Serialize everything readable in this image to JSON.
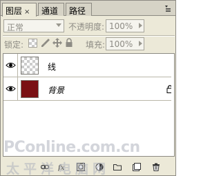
{
  "tabs": [
    {
      "label": "图层",
      "close": "×",
      "active": true
    },
    {
      "label": "通道",
      "active": false
    },
    {
      "label": "路径",
      "active": false
    }
  ],
  "panel_menu_icon": "panel-menu-icon",
  "blend_mode": {
    "value": "正常"
  },
  "opacity": {
    "label": "不透明度:",
    "value": "100%"
  },
  "lock": {
    "label": "锁定:",
    "icons": [
      "lock-transparent-icon",
      "lock-paint-icon",
      "lock-move-icon",
      "lock-all-icon"
    ]
  },
  "fill": {
    "label": "填充:",
    "value": "100%"
  },
  "layers": [
    {
      "name": "线",
      "visible": true,
      "thumbnail": "transparent",
      "locked": false,
      "italic": false
    },
    {
      "name": "背景",
      "visible": true,
      "thumbnail": "#7a1114",
      "locked": true,
      "italic": true
    }
  ],
  "bottom_toolbar": [
    "link-layers-icon",
    "layer-style-icon",
    "layer-mask-icon",
    "adjustment-layer-icon",
    "new-group-icon",
    "new-layer-icon",
    "delete-layer-icon"
  ],
  "watermark": {
    "main": "PConline.com.cn",
    "sub": "太平洋电脑网"
  },
  "colors": {
    "panel_bg": "#ece9d8",
    "background_layer": "#7a1114",
    "disabled_text": "#8d8b84"
  }
}
